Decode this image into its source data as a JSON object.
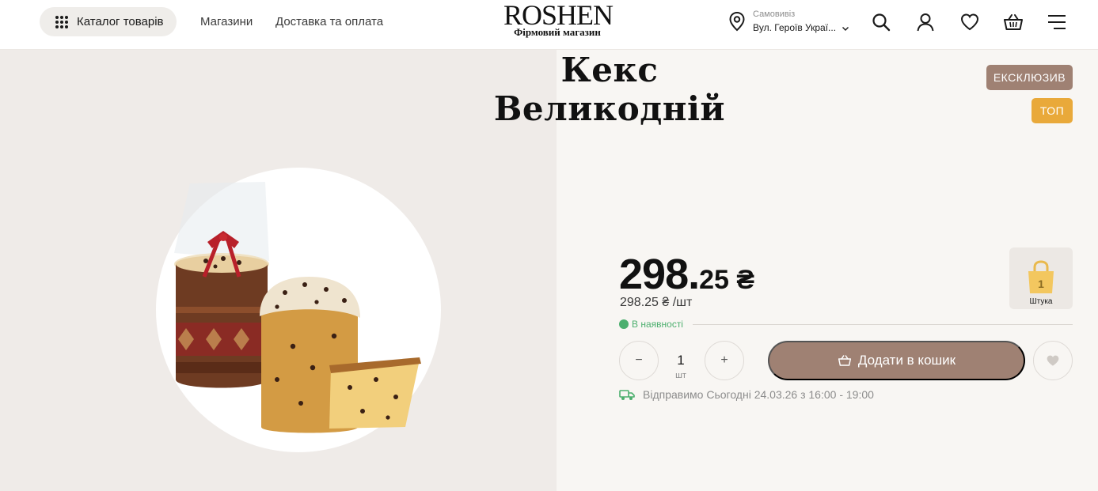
{
  "header": {
    "catalog_label": "Каталог товарів",
    "nav": [
      "Магазини",
      "Доставка та оплата"
    ],
    "logo_main": "ROSHEN",
    "logo_sub": "Фірмовий магазин",
    "pickup_caption": "Самовивіз",
    "pickup_address": "Вул. Героїв Украї...",
    "icons": [
      "search-icon",
      "user-icon",
      "heart-icon",
      "basket-icon",
      "menu-icon"
    ]
  },
  "product": {
    "title": "Кекс Великодній",
    "badges": [
      "ЕКСКЛЮЗИВ",
      "ТОП"
    ],
    "price_int": "298.",
    "price_dec": "25 ₴",
    "price_per_unit": "298.25 ₴ /шт",
    "unit_count": "1",
    "unit_label": "Штука",
    "stock_status": "В наявності",
    "quantity": "1",
    "quantity_unit": "шт",
    "minus_label": "−",
    "plus_label": "+",
    "add_to_cart": "Додати в кошик",
    "delivery_text": "Відправимо Сьогодні 24.03.26 з 16:00 - 19:00"
  },
  "colors": {
    "accent": "#9f8173",
    "top_badge": "#e9a93a",
    "in_stock": "#4caf6e",
    "left_panel_bg": "#efebe8",
    "right_panel_bg": "#f8f6f3"
  }
}
